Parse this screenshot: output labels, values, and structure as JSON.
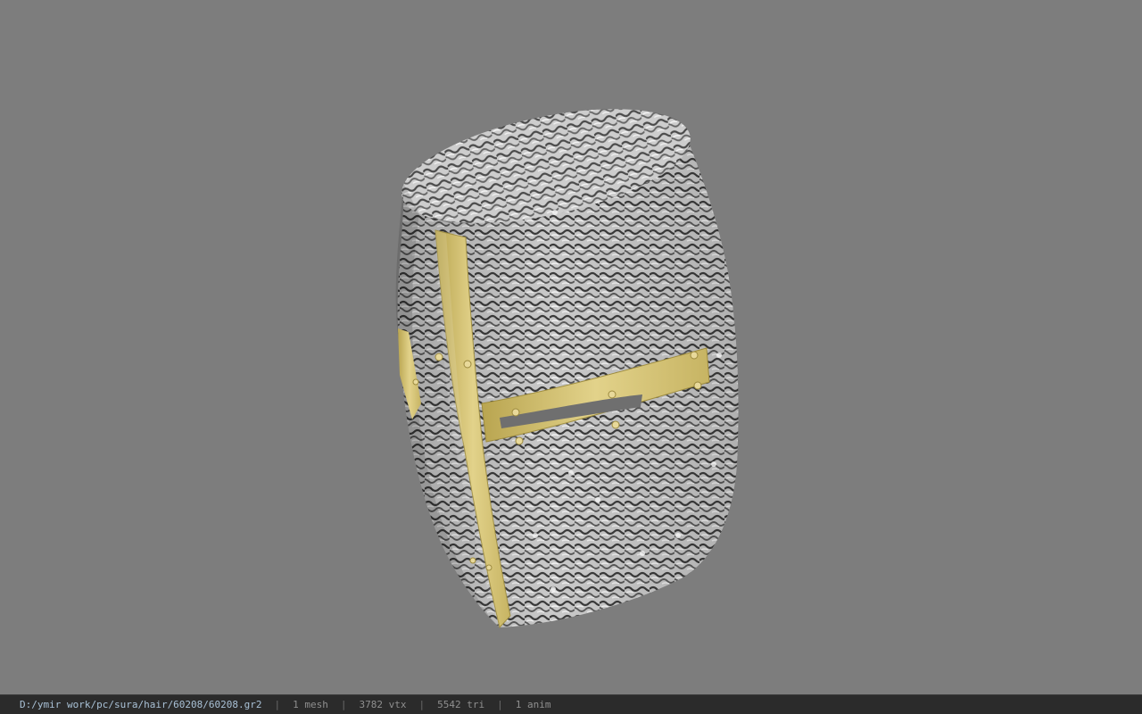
{
  "viewer": {
    "background_color": "#7d7d7d",
    "model": "great-helm",
    "metal_color": "#d7c57a",
    "mail_color": "#bdbdbd"
  },
  "statusbar": {
    "file_path": "D:/ymir work/pc/sura/hair/60208/60208.gr2",
    "mesh_count": "1 mesh",
    "vertex_count": "3782 vtx",
    "triangle_count": "5542 tri",
    "anim_count": "1 anim"
  }
}
